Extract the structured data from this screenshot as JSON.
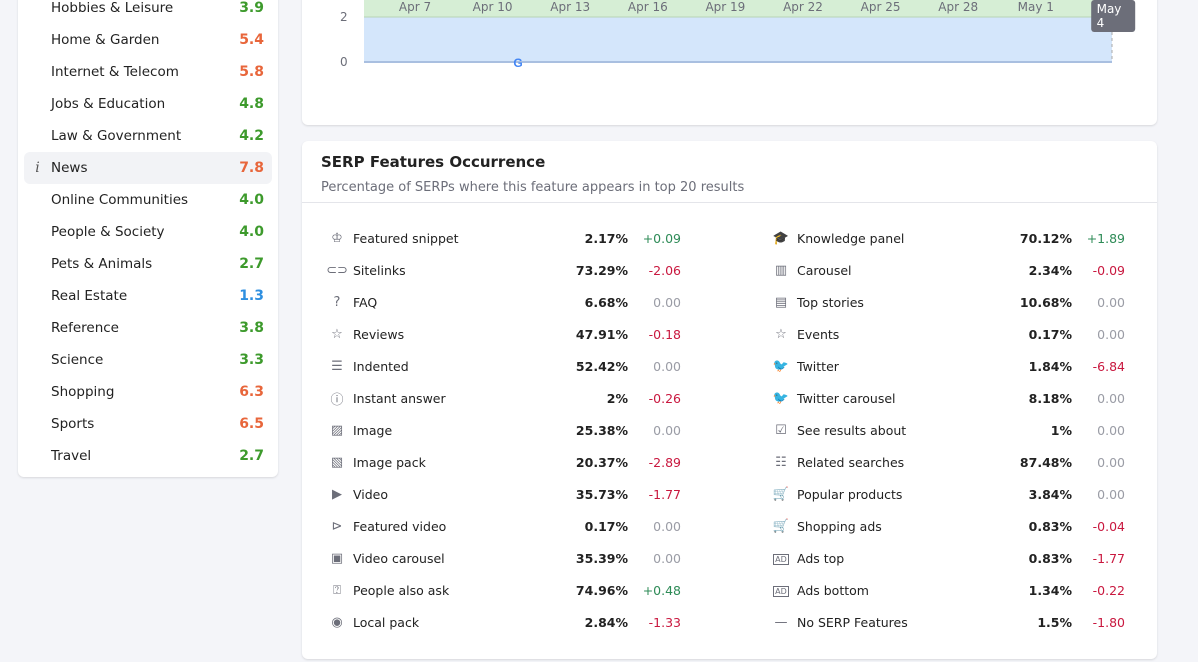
{
  "sidebar": {
    "items": [
      {
        "label": "Hobbies & Leisure",
        "value": "3.9",
        "color": "#3d9a2c"
      },
      {
        "label": "Home & Garden",
        "value": "5.4",
        "color": "#e8663b"
      },
      {
        "label": "Internet & Telecom",
        "value": "5.8",
        "color": "#e8663b"
      },
      {
        "label": "Jobs & Education",
        "value": "4.8",
        "color": "#3d9a2c"
      },
      {
        "label": "Law & Government",
        "value": "4.2",
        "color": "#3d9a2c"
      },
      {
        "label": "News",
        "value": "7.8",
        "color": "#e8663b",
        "active": true
      },
      {
        "label": "Online Communities",
        "value": "4.0",
        "color": "#3d9a2c"
      },
      {
        "label": "People & Society",
        "value": "4.0",
        "color": "#3d9a2c"
      },
      {
        "label": "Pets & Animals",
        "value": "2.7",
        "color": "#3d9a2c"
      },
      {
        "label": "Real Estate",
        "value": "1.3",
        "color": "#2e8fe0"
      },
      {
        "label": "Reference",
        "value": "3.8",
        "color": "#3d9a2c"
      },
      {
        "label": "Science",
        "value": "3.3",
        "color": "#3d9a2c"
      },
      {
        "label": "Shopping",
        "value": "6.3",
        "color": "#e8663b"
      },
      {
        "label": "Sports",
        "value": "6.5",
        "color": "#e8663b"
      },
      {
        "label": "Travel",
        "value": "2.7",
        "color": "#3d9a2c"
      }
    ],
    "info_icon": "i"
  },
  "chart_data": {
    "type": "area",
    "x_ticks": [
      "Apr 7",
      "Apr 10",
      "Apr 13",
      "Apr 16",
      "Apr 19",
      "Apr 22",
      "Apr 25",
      "Apr 28",
      "May 1",
      "May 4"
    ],
    "y_ticks": [
      "0",
      "2"
    ],
    "highlighted_x": "May 4",
    "series_colors": [
      "#d4e6fb",
      "#d6eed5"
    ],
    "annotation": "google-update-marker at Apr 10"
  },
  "serp": {
    "title": "SERP Features Occurrence",
    "subtitle": "Percentage of SERPs where this feature appears in top 20 results",
    "colors": {
      "positive": "#2e8b57",
      "negative": "#c9183f",
      "neutral": "#9a9ca5"
    },
    "left": [
      {
        "icon": "crown-icon",
        "glyph": "♔",
        "label": "Featured snippet",
        "pct": "2.17%",
        "delta": "+0.09"
      },
      {
        "icon": "link-icon",
        "glyph": "⊂⊃",
        "label": "Sitelinks",
        "pct": "73.29%",
        "delta": "-2.06"
      },
      {
        "icon": "question-icon",
        "glyph": "?",
        "label": "FAQ",
        "pct": "6.68%",
        "delta": "0.00"
      },
      {
        "icon": "star-icon",
        "glyph": "☆",
        "label": "Reviews",
        "pct": "47.91%",
        "delta": "-0.18"
      },
      {
        "icon": "indented-icon",
        "glyph": "☰",
        "label": "Indented",
        "pct": "52.42%",
        "delta": "0.00"
      },
      {
        "icon": "question-circle-icon",
        "glyph": "ⓘ",
        "label": "Instant answer",
        "pct": "2%",
        "delta": "-0.26"
      },
      {
        "icon": "image-icon",
        "glyph": "▨",
        "label": "Image",
        "pct": "25.38%",
        "delta": "0.00"
      },
      {
        "icon": "image-pack-icon",
        "glyph": "▧",
        "label": "Image pack",
        "pct": "20.37%",
        "delta": "-2.89"
      },
      {
        "icon": "video-icon",
        "glyph": "▶",
        "label": "Video",
        "pct": "35.73%",
        "delta": "-1.77"
      },
      {
        "icon": "play-circle-icon",
        "glyph": "⊳",
        "label": "Featured video",
        "pct": "0.17%",
        "delta": "0.00"
      },
      {
        "icon": "video-carousel-icon",
        "glyph": "▣",
        "label": "Video carousel",
        "pct": "35.39%",
        "delta": "0.00"
      },
      {
        "icon": "people-ask-icon",
        "glyph": "⍰",
        "label": "People also ask",
        "pct": "74.96%",
        "delta": "+0.48"
      },
      {
        "icon": "location-pin-icon",
        "glyph": "◉",
        "label": "Local pack",
        "pct": "2.84%",
        "delta": "-1.33"
      }
    ],
    "right": [
      {
        "icon": "graduation-cap-icon",
        "glyph": "🎓",
        "label": "Knowledge panel",
        "pct": "70.12%",
        "delta": "+1.89"
      },
      {
        "icon": "carousel-icon",
        "glyph": "▥",
        "label": "Carousel",
        "pct": "2.34%",
        "delta": "-0.09"
      },
      {
        "icon": "news-icon",
        "glyph": "▤",
        "label": "Top stories",
        "pct": "10.68%",
        "delta": "0.00"
      },
      {
        "icon": "calendar-star-icon",
        "glyph": "☆",
        "label": "Events",
        "pct": "0.17%",
        "delta": "0.00"
      },
      {
        "icon": "twitter-icon",
        "glyph": "🐦",
        "label": "Twitter",
        "pct": "1.84%",
        "delta": "-6.84"
      },
      {
        "icon": "twitter-carousel-icon",
        "glyph": "🐦",
        "label": "Twitter carousel",
        "pct": "8.18%",
        "delta": "0.00"
      },
      {
        "icon": "see-results-icon",
        "glyph": "☑",
        "label": "See results about",
        "pct": "1%",
        "delta": "0.00"
      },
      {
        "icon": "list-icon",
        "glyph": "☷",
        "label": "Related searches",
        "pct": "87.48%",
        "delta": "0.00"
      },
      {
        "icon": "cart-icon",
        "glyph": "🛒",
        "label": "Popular products",
        "pct": "3.84%",
        "delta": "0.00"
      },
      {
        "icon": "shopping-cart-icon",
        "glyph": "🛒",
        "label": "Shopping ads",
        "pct": "0.83%",
        "delta": "-0.04"
      },
      {
        "icon": "ads-top-icon",
        "glyph": "AD",
        "label": "Ads top",
        "pct": "0.83%",
        "delta": "-1.77"
      },
      {
        "icon": "ads-bottom-icon",
        "glyph": "AD",
        "label": "Ads bottom",
        "pct": "1.34%",
        "delta": "-0.22"
      },
      {
        "icon": "dash-icon",
        "glyph": "—",
        "label": "No SERP Features",
        "pct": "1.5%",
        "delta": "-1.80"
      }
    ]
  }
}
